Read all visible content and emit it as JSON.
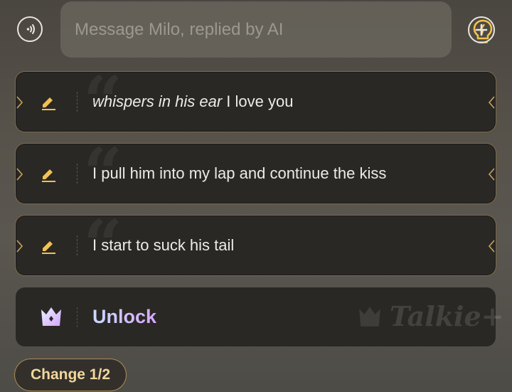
{
  "composer": {
    "placeholder": "Message Milo, replied by AI"
  },
  "suggestions": [
    {
      "italic": "whispers in his ear",
      "text": " I love you"
    },
    {
      "italic": "",
      "text": "I pull him into my lap and continue the kiss"
    },
    {
      "italic": "",
      "text": "I start to suck his tail"
    }
  ],
  "unlock": {
    "label": "Unlock",
    "watermark": "Talkie+"
  },
  "change": {
    "label": "Change 1/2"
  },
  "colors": {
    "accent_gold": "#f2c14e",
    "card_bg": "#2a2825",
    "unlock_gradient_start": "#c9d9ff",
    "unlock_gradient_end": "#d8a9ff"
  },
  "icons": [
    "voice-icon",
    "lightbulb-icon",
    "plus-icon",
    "pencil-icon",
    "crown-icon"
  ]
}
